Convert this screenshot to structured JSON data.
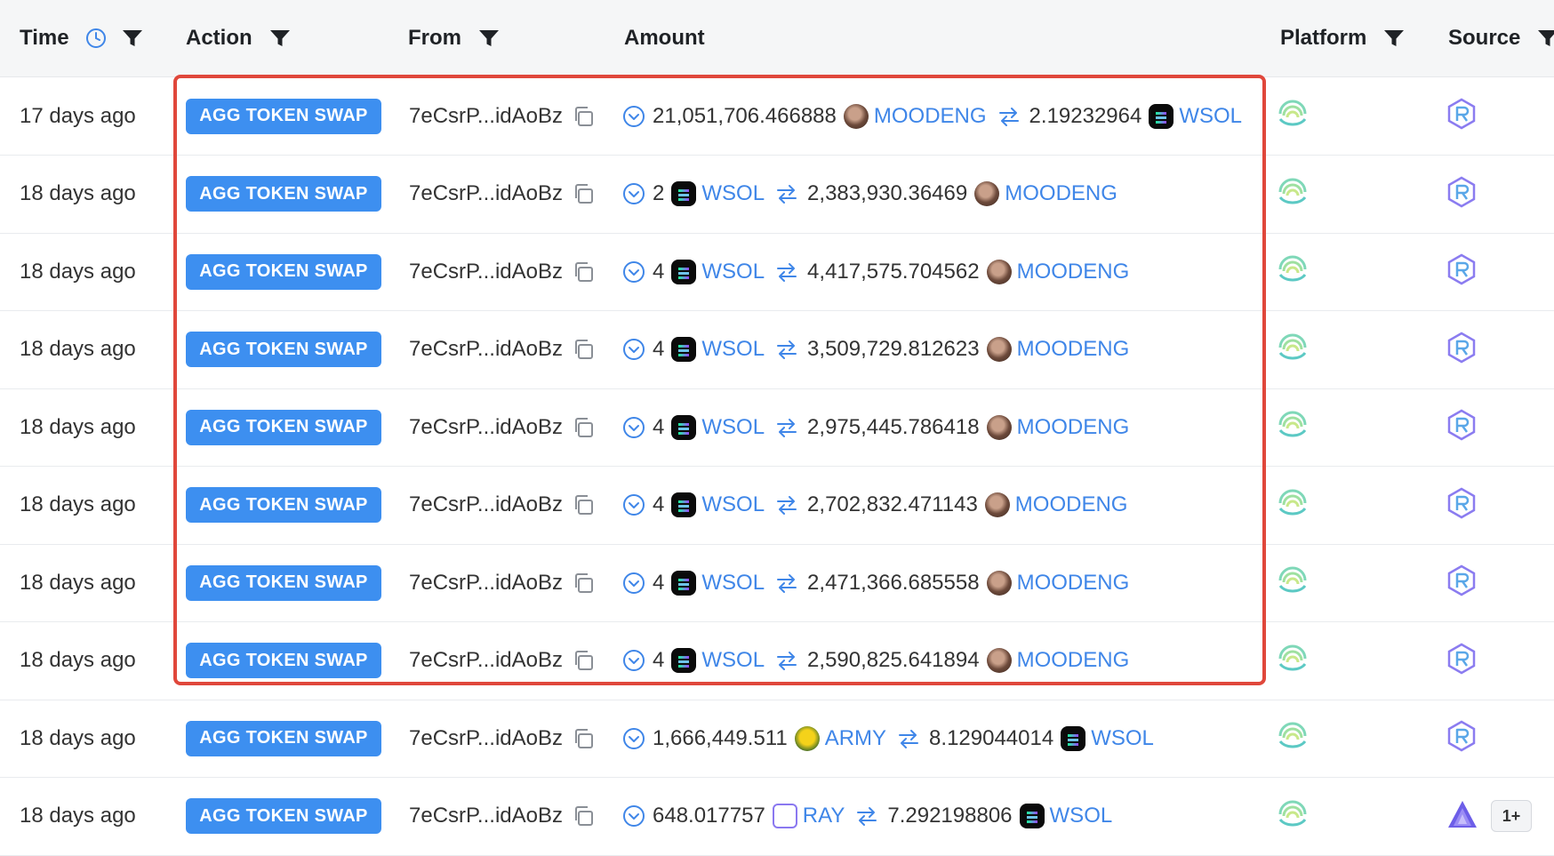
{
  "columns": {
    "time": "Time",
    "action": "Action",
    "from": "From",
    "amount": "Amount",
    "platform": "Platform",
    "source": "Source"
  },
  "colors": {
    "accent": "#3d8ff0",
    "link": "#3f86e8",
    "highlight": "#e0473b"
  },
  "rows": [
    {
      "time": "17 days ago",
      "action": "AGG TOKEN SWAP",
      "from": "7eCsrP...idAoBz",
      "amount_in": "21,051,706.466888",
      "token_in": "MOODENG",
      "amount_out": "2.19232964",
      "token_out": "WSOL",
      "source_icon": "raydium-icon",
      "extra": ""
    },
    {
      "time": "18 days ago",
      "action": "AGG TOKEN SWAP",
      "from": "7eCsrP...idAoBz",
      "amount_in": "2",
      "token_in": "WSOL",
      "amount_out": "2,383,930.36469",
      "token_out": "MOODENG",
      "source_icon": "raydium-icon",
      "extra": ""
    },
    {
      "time": "18 days ago",
      "action": "AGG TOKEN SWAP",
      "from": "7eCsrP...idAoBz",
      "amount_in": "4",
      "token_in": "WSOL",
      "amount_out": "4,417,575.704562",
      "token_out": "MOODENG",
      "source_icon": "raydium-icon",
      "extra": ""
    },
    {
      "time": "18 days ago",
      "action": "AGG TOKEN SWAP",
      "from": "7eCsrP...idAoBz",
      "amount_in": "4",
      "token_in": "WSOL",
      "amount_out": "3,509,729.812623",
      "token_out": "MOODENG",
      "source_icon": "raydium-icon",
      "extra": ""
    },
    {
      "time": "18 days ago",
      "action": "AGG TOKEN SWAP",
      "from": "7eCsrP...idAoBz",
      "amount_in": "4",
      "token_in": "WSOL",
      "amount_out": "2,975,445.786418",
      "token_out": "MOODENG",
      "source_icon": "raydium-icon",
      "extra": ""
    },
    {
      "time": "18 days ago",
      "action": "AGG TOKEN SWAP",
      "from": "7eCsrP...idAoBz",
      "amount_in": "4",
      "token_in": "WSOL",
      "amount_out": "2,702,832.471143",
      "token_out": "MOODENG",
      "source_icon": "raydium-icon",
      "extra": ""
    },
    {
      "time": "18 days ago",
      "action": "AGG TOKEN SWAP",
      "from": "7eCsrP...idAoBz",
      "amount_in": "4",
      "token_in": "WSOL",
      "amount_out": "2,471,366.685558",
      "token_out": "MOODENG",
      "source_icon": "raydium-icon",
      "extra": ""
    },
    {
      "time": "18 days ago",
      "action": "AGG TOKEN SWAP",
      "from": "7eCsrP...idAoBz",
      "amount_in": "4",
      "token_in": "WSOL",
      "amount_out": "2,590,825.641894",
      "token_out": "MOODENG",
      "source_icon": "raydium-icon",
      "extra": ""
    },
    {
      "time": "18 days ago",
      "action": "AGG TOKEN SWAP",
      "from": "7eCsrP...idAoBz",
      "amount_in": "1,666,449.511",
      "token_in": "ARMY",
      "amount_out": "8.129044014",
      "token_out": "WSOL",
      "source_icon": "raydium-icon",
      "extra": ""
    },
    {
      "time": "18 days ago",
      "action": "AGG TOKEN SWAP",
      "from": "7eCsrP...idAoBz",
      "amount_in": "648.017757",
      "token_in": "RAY",
      "amount_out": "7.292198806",
      "token_out": "WSOL",
      "source_icon": "meteora-icon",
      "extra": "1+"
    }
  ]
}
